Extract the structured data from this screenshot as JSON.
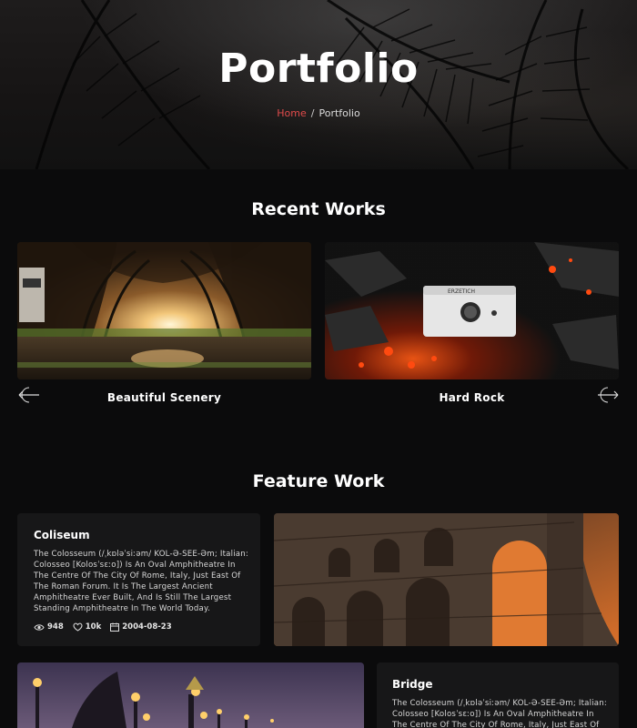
{
  "hero": {
    "title": "Portfolio",
    "breadcrumb": {
      "home": "Home",
      "separator": "/",
      "current": "Portfolio"
    }
  },
  "recent_works": {
    "title": "Recent Works",
    "items": [
      {
        "caption": "Beautiful Scenery",
        "image": "forest-tunnel-photo"
      },
      {
        "caption": "Hard Rock",
        "image": "amplifier-on-embers-photo"
      }
    ],
    "prev_icon": "arrow-left-icon",
    "next_icon": "arrow-right-icon"
  },
  "feature_work": {
    "title": "Feature Work",
    "items": [
      {
        "title": "Coliseum",
        "lines": [
          "The Colosseum (/ˌkɒləˈsiːəm/ KOL-Ə-SEE-Əm; Italian:",
          "Colosseo [Kolosˈsɛːo]) Is An Oval Amphitheatre In",
          "The Centre Of The City Of Rome, Italy, Just East Of",
          "The Roman Forum. It Is The Largest Ancient",
          "Amphitheatre Ever Built, And Is Still The Largest",
          "Standing Amphitheatre In The World Today."
        ],
        "views": "948",
        "likes": "10k",
        "date": "2004-08-23",
        "image": "colosseum-photo"
      },
      {
        "title": "Bridge",
        "lines": [
          "The Colosseum (/ˌkɒləˈsiːəm/ KOL-Ə-SEE-Əm; Italian:",
          "Colosseo [Kolosˈsɛːo]) Is An Oval Amphitheatre In",
          "The Centre Of The City Of Rome, Italy, Just East Of"
        ],
        "image": "bridge-lamps-photo"
      }
    ]
  },
  "colors": {
    "accent": "#e14b4b",
    "background": "#0b0b0c",
    "card": "#171718"
  }
}
